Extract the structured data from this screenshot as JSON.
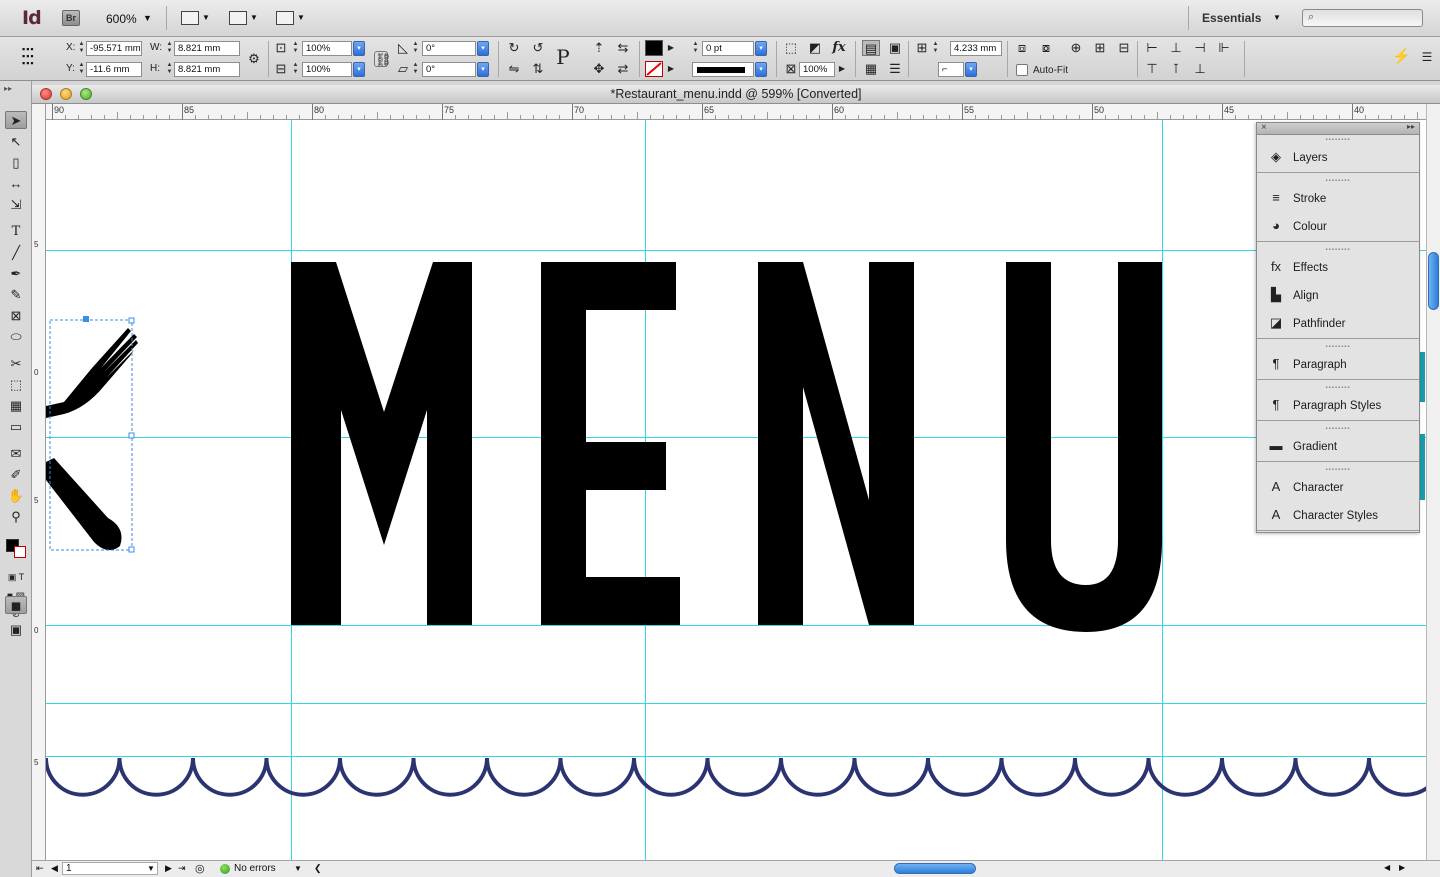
{
  "app": {
    "logo": "Id",
    "bridge": "Br",
    "zoom": "600%",
    "workspace": "Essentials",
    "search_placeholder": "⌕"
  },
  "control": {
    "x_label": "X:",
    "x_value": "-95.571 mm",
    "y_label": "Y:",
    "y_value": "-11.6 mm",
    "w_label": "W:",
    "w_value": "8.821 mm",
    "h_label": "H:",
    "h_value": "8.821 mm",
    "scale_x": "100%",
    "scale_y": "100%",
    "rotate": "0°",
    "shear": "0°",
    "stroke_weight": "0 pt",
    "opacity": "100%",
    "offset": "4.233 mm",
    "autofit_label": "Auto-Fit"
  },
  "document": {
    "title": "*Restaurant_menu.indd @ 599% [Converted]",
    "ruler_h": [
      "90",
      "85",
      "80",
      "75",
      "70",
      "65",
      "60",
      "55",
      "50",
      "45",
      "40"
    ],
    "ruler_v": [
      "5",
      "0",
      "5",
      "0",
      "5"
    ],
    "headline": "MENU",
    "scallop_color": "#2b3470"
  },
  "status": {
    "page": "1",
    "preflight": "No errors"
  },
  "panels": [
    {
      "items": [
        {
          "icon": "layers-icon",
          "glyph": "◈",
          "label": "Layers"
        }
      ]
    },
    {
      "items": [
        {
          "icon": "stroke-icon",
          "glyph": "≡",
          "label": "Stroke"
        },
        {
          "icon": "colour-icon",
          "glyph": "◕",
          "label": "Colour"
        }
      ]
    },
    {
      "items": [
        {
          "icon": "effects-icon",
          "glyph": "fx",
          "label": "Effects"
        },
        {
          "icon": "align-icon",
          "glyph": "▙",
          "label": "Align"
        },
        {
          "icon": "pathfinder-icon",
          "glyph": "◪",
          "label": "Pathfinder"
        }
      ]
    },
    {
      "items": [
        {
          "icon": "paragraph-icon",
          "glyph": "¶",
          "label": "Paragraph"
        }
      ]
    },
    {
      "items": [
        {
          "icon": "paragraph-styles-icon",
          "glyph": "¶",
          "label": "Paragraph Styles"
        }
      ]
    },
    {
      "items": [
        {
          "icon": "gradient-icon",
          "glyph": "▬",
          "label": "Gradient"
        }
      ]
    },
    {
      "items": [
        {
          "icon": "character-icon",
          "glyph": "A",
          "label": "Character"
        },
        {
          "icon": "character-styles-icon",
          "glyph": "A",
          "label": "Character Styles"
        }
      ]
    }
  ]
}
